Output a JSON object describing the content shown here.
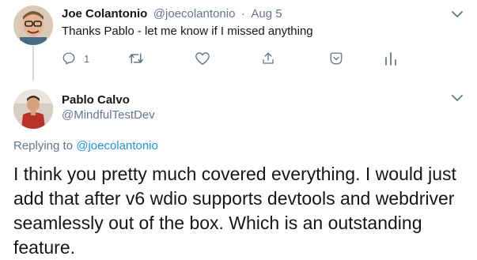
{
  "tweet1": {
    "display_name": "Joe Colantonio",
    "handle": "@joecolantonio",
    "separator": "·",
    "date": "Aug 5",
    "text": "Thanks Pablo - let me know if I missed anything",
    "reply_count": "1",
    "actions": [
      "reply-icon",
      "retweet-icon",
      "like-icon",
      "share-icon",
      "heart-plus-icon",
      "analytics-icon"
    ]
  },
  "tweet2": {
    "display_name": "Pablo Calvo",
    "handle": "@MindfulTestDev",
    "replying_prefix": "Replying to",
    "replying_handle": "@joecolantonio",
    "text": "I think you pretty much covered everything. I would just add that after v6 wdio supports devtools and webdriver seamlessly out of the box. Which is an outstanding feature."
  },
  "colors": {
    "link": "#1b95e0",
    "muted": "#657786",
    "text": "#14171a",
    "thread_line": "#cfd9de"
  }
}
